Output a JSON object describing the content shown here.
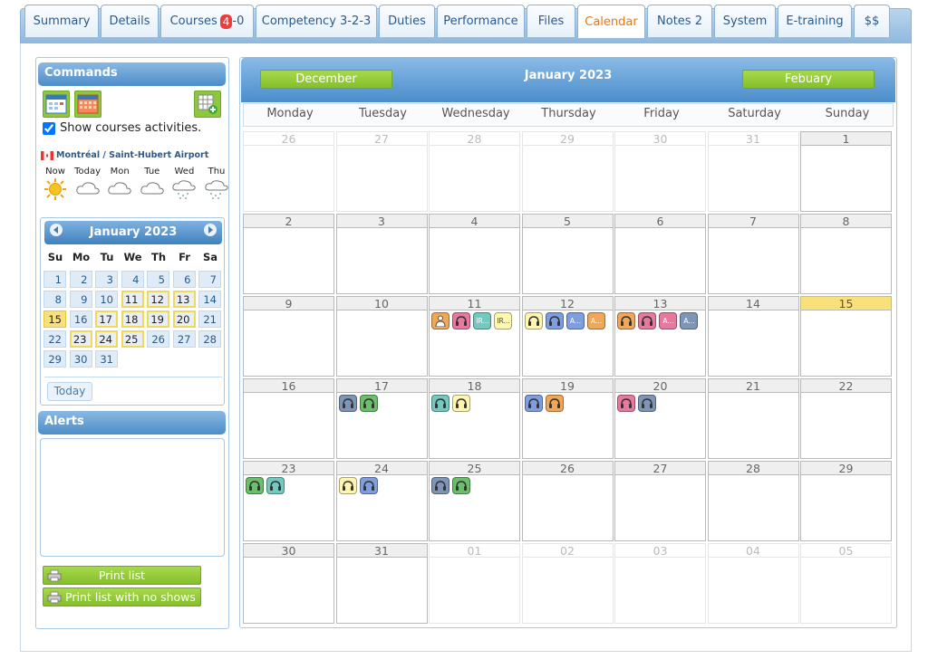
{
  "tabs": [
    {
      "label": "Summary"
    },
    {
      "label": "Details"
    },
    {
      "label": "Courses",
      "badge": "4",
      "suffix": "-0"
    },
    {
      "label": "Competency 3-2-3"
    },
    {
      "label": "Duties"
    },
    {
      "label": "Performance"
    },
    {
      "label": "Files"
    },
    {
      "label": "Calendar",
      "active": true
    },
    {
      "label": "Notes 2"
    },
    {
      "label": "System"
    },
    {
      "label": "E-training"
    },
    {
      "label": "$$"
    }
  ],
  "commands": {
    "title": "Commands",
    "show_courses_label": "Show courses activities.",
    "show_courses_checked": true
  },
  "weather": {
    "location": "Montréal / Saint-Hubert Airport",
    "days": [
      {
        "label": "Now",
        "icon": "sun-icon"
      },
      {
        "label": "Today",
        "icon": "cloud-icon"
      },
      {
        "label": "Mon",
        "icon": "cloud-icon"
      },
      {
        "label": "Tue",
        "icon": "cloud-icon"
      },
      {
        "label": "Wed",
        "icon": "snow-icon"
      },
      {
        "label": "Thu",
        "icon": "snow-icon"
      }
    ]
  },
  "mini_calendar": {
    "title": "January 2023",
    "dow": [
      "Su",
      "Mo",
      "Tu",
      "We",
      "Th",
      "Fr",
      "Sa"
    ],
    "weeks": [
      [
        "1",
        "2",
        "3",
        "4",
        "5",
        "6",
        "7"
      ],
      [
        "8",
        "9",
        "10",
        "11",
        "12",
        "13",
        "14"
      ],
      [
        "15",
        "16",
        "17",
        "18",
        "19",
        "20",
        "21"
      ],
      [
        "22",
        "23",
        "24",
        "25",
        "26",
        "27",
        "28"
      ],
      [
        "29",
        "30",
        "31",
        "",
        "",
        "",
        ""
      ]
    ],
    "today": "15",
    "highlighted": [
      "11",
      "12",
      "13",
      "17",
      "18",
      "19",
      "20",
      "23",
      "24",
      "25"
    ],
    "today_button": "Today"
  },
  "alerts": {
    "title": "Alerts"
  },
  "print": {
    "list": "Print list",
    "list_no_shows": "Print list with no shows"
  },
  "calendar": {
    "month_title": "January 2023",
    "prev_label": "December",
    "next_label": "Febuary",
    "dow": [
      "Monday",
      "Tuesday",
      "Wednesday",
      "Thursday",
      "Friday",
      "Saturday",
      "Sunday"
    ],
    "weeks": [
      [
        {
          "d": "26",
          "other": true
        },
        {
          "d": "27",
          "other": true
        },
        {
          "d": "28",
          "other": true
        },
        {
          "d": "29",
          "other": true
        },
        {
          "d": "30",
          "other": true
        },
        {
          "d": "31",
          "other": true
        },
        {
          "d": "1"
        }
      ],
      [
        {
          "d": "2"
        },
        {
          "d": "3"
        },
        {
          "d": "4"
        },
        {
          "d": "5"
        },
        {
          "d": "6"
        },
        {
          "d": "7"
        },
        {
          "d": "8"
        }
      ],
      [
        {
          "d": "9"
        },
        {
          "d": "10"
        },
        {
          "d": "11",
          "events": [
            {
              "c": "orange",
              "i": "person"
            },
            {
              "c": "pink",
              "i": "headset"
            },
            {
              "c": "teal",
              "t": "IR..."
            },
            {
              "c": "yellow",
              "t": "IR..."
            }
          ]
        },
        {
          "d": "12",
          "events": [
            {
              "c": "yellow",
              "i": "headset"
            },
            {
              "c": "blue",
              "i": "headset"
            },
            {
              "c": "blue",
              "t": "A..."
            },
            {
              "c": "orange",
              "t": "A..."
            }
          ]
        },
        {
          "d": "13",
          "events": [
            {
              "c": "orange",
              "i": "headset"
            },
            {
              "c": "pink",
              "i": "headset"
            },
            {
              "c": "pink",
              "t": "A..."
            },
            {
              "c": "slate",
              "t": "A..."
            }
          ]
        },
        {
          "d": "14"
        },
        {
          "d": "15",
          "today": true
        }
      ],
      [
        {
          "d": "16"
        },
        {
          "d": "17",
          "events": [
            {
              "c": "slate",
              "i": "headset"
            },
            {
              "c": "green",
              "i": "headset"
            }
          ]
        },
        {
          "d": "18",
          "events": [
            {
              "c": "teal",
              "i": "headset"
            },
            {
              "c": "yellow",
              "i": "headset"
            }
          ]
        },
        {
          "d": "19",
          "events": [
            {
              "c": "blue",
              "i": "headset"
            },
            {
              "c": "orange",
              "i": "headset"
            }
          ]
        },
        {
          "d": "20",
          "events": [
            {
              "c": "pink",
              "i": "headset"
            },
            {
              "c": "slate",
              "i": "headset"
            }
          ]
        },
        {
          "d": "21"
        },
        {
          "d": "22"
        }
      ],
      [
        {
          "d": "23",
          "events": [
            {
              "c": "green",
              "i": "headset"
            },
            {
              "c": "teal",
              "i": "headset"
            }
          ]
        },
        {
          "d": "24",
          "events": [
            {
              "c": "yellow",
              "i": "headset"
            },
            {
              "c": "blue",
              "i": "headset"
            }
          ]
        },
        {
          "d": "25",
          "events": [
            {
              "c": "slate",
              "i": "headset"
            },
            {
              "c": "green",
              "i": "headset"
            }
          ]
        },
        {
          "d": "26"
        },
        {
          "d": "27"
        },
        {
          "d": "28"
        },
        {
          "d": "29"
        }
      ],
      [
        {
          "d": "30"
        },
        {
          "d": "31"
        },
        {
          "d": "01",
          "other": true
        },
        {
          "d": "02",
          "other": true
        },
        {
          "d": "03",
          "other": true
        },
        {
          "d": "04",
          "other": true
        },
        {
          "d": "05",
          "other": true
        }
      ]
    ]
  },
  "colors": {
    "accent": "#e87813",
    "header_blue": "#4b8dcb",
    "green_button": "#8dc63f",
    "today_yellow": "#f9e07a",
    "ev_orange": "#f0a858",
    "ev_pink": "#e8799e",
    "ev_teal": "#73c9bd",
    "ev_yellow": "#fff6b0",
    "ev_blue": "#7f9ee0",
    "ev_slate": "#7f95b8",
    "ev_green": "#6bbf6a"
  }
}
